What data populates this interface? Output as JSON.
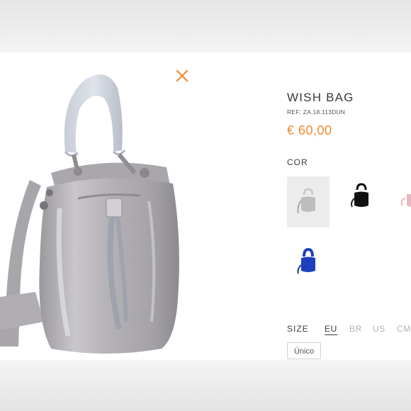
{
  "product": {
    "title": "WISH BAG",
    "ref": "REF: ZA.18.113DUN",
    "price": "€ 60,00"
  },
  "colors": {
    "label": "COR",
    "options": [
      {
        "name": "grey",
        "hex": "#bdbdbd",
        "selected": true
      },
      {
        "name": "black",
        "hex": "#111111",
        "selected": false
      },
      {
        "name": "pink",
        "hex": "#e7b7c2",
        "selected": false
      },
      {
        "name": "blue",
        "hex": "#1f3fbf",
        "selected": false
      }
    ]
  },
  "size": {
    "label": "SIZE",
    "systems": [
      "EU",
      "BR",
      "US",
      "CM"
    ],
    "active_system": "EU",
    "options": [
      "Único"
    ]
  },
  "icons": {
    "close": "close-icon",
    "accent_color": "#f08a33"
  }
}
